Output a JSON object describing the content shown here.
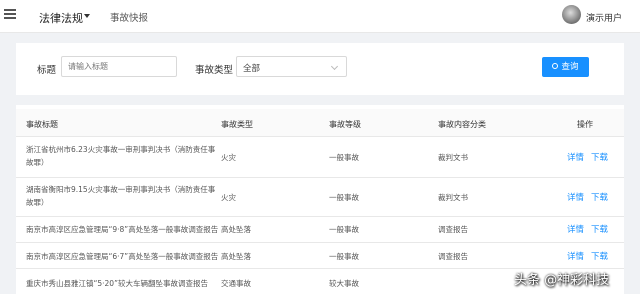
{
  "header": {
    "module_label": "法律法规",
    "nav_label": "事故快报",
    "user_name": "演示用户"
  },
  "filter": {
    "title_label": "标题",
    "title_placeholder": "请输入标题",
    "type_label": "事故类型",
    "type_value": "全部",
    "search_label": "查询"
  },
  "table": {
    "columns": [
      "事故标题",
      "事故类型",
      "事故等级",
      "事故内容分类",
      "操作"
    ],
    "rows": [
      {
        "title": "浙江省杭州市6.23火灾事故一审刑事判决书（消防责任事故罪）",
        "type": "火灾",
        "level": "一般事故",
        "category": "裁判文书"
      },
      {
        "title": "湖南省衡阳市9.15火灾事故一审刑事判决书（消防责任事故罪）",
        "type": "火灾",
        "level": "一般事故",
        "category": "裁判文书"
      },
      {
        "title": "南京市高淳区应急管理局“9·8”高处坠落一般事故调查报告",
        "type": "高处坠落",
        "level": "一般事故",
        "category": "调查报告"
      },
      {
        "title": "南京市高淳区应急管理局“6·7”高处坠落一般事故调查报告",
        "type": "高处坠落",
        "level": "一般事故",
        "category": "调查报告"
      },
      {
        "title": "重庆市秀山县雅江镇“5·20”较大车辆翻坠事故调查报告",
        "type": "交通事故",
        "level": "较大事故",
        "category": ""
      }
    ],
    "detail_label": "详情",
    "download_label": "下载"
  },
  "watermark": "头条 @神彩科技",
  "colors": {
    "primary": "#1890ff",
    "background": "#f0f2f5"
  }
}
